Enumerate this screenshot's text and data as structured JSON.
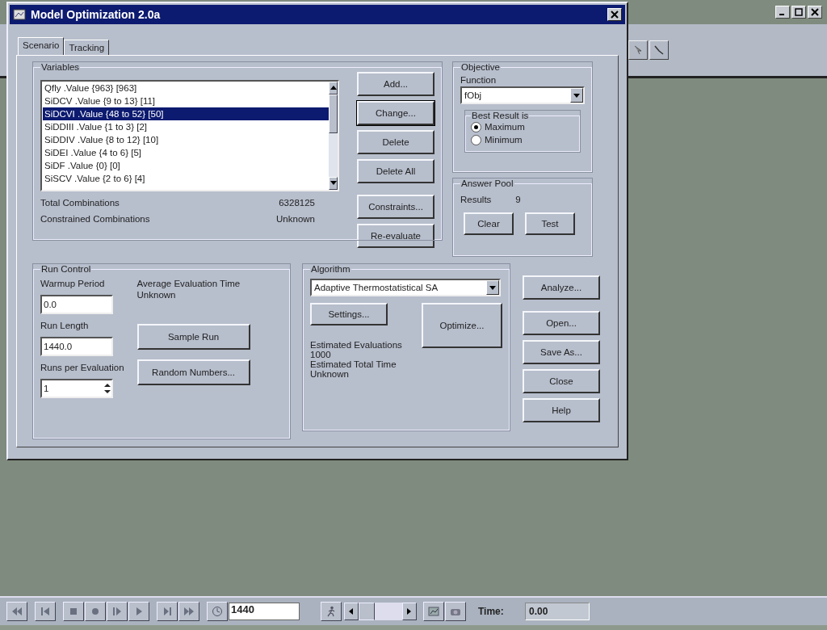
{
  "dialog": {
    "title": "Model Optimization 2.0a"
  },
  "tabs": [
    {
      "label": "Scenario",
      "selected": true
    },
    {
      "label": "Tracking",
      "selected": false
    }
  ],
  "variables": {
    "label": "Variables",
    "items": [
      {
        "text": "Qfly .Value {963} [963]",
        "selected": false
      },
      {
        "text": "SiDCV .Value {9 to 13} [11]",
        "selected": false
      },
      {
        "text": "SiDCVI .Value {48 to 52} [50]",
        "selected": true
      },
      {
        "text": "SiDDIII .Value {1 to 3} [2]",
        "selected": false
      },
      {
        "text": "SiDDIV .Value {8 to 12} [10]",
        "selected": false
      },
      {
        "text": "SiDEI .Value {4 to 6} [5]",
        "selected": false
      },
      {
        "text": "SiDF .Value {0} [0]",
        "selected": false
      },
      {
        "text": "SiSCV .Value {2 to 6} [4]",
        "selected": false
      }
    ],
    "total_label": "Total Combinations",
    "total_value": "6328125",
    "constrained_label": "Constrained Combinations",
    "constrained_value": "Unknown",
    "buttons": [
      {
        "label": "Add...",
        "focused": false
      },
      {
        "label": "Change...",
        "focused": true
      },
      {
        "label": "Delete",
        "focused": false
      },
      {
        "label": "Delete All",
        "focused": false
      },
      {
        "label": "Constraints...",
        "focused": false
      },
      {
        "label": "Re-evaluate",
        "focused": false
      }
    ]
  },
  "objective": {
    "label": "Objective",
    "function_label": "Function",
    "function_value": "fObj",
    "best_label": "Best Result is",
    "options": [
      {
        "label": "Maximum",
        "selected": true
      },
      {
        "label": "Minimum",
        "selected": false
      }
    ]
  },
  "answer_pool": {
    "label": "Answer Pool",
    "results_label": "Results",
    "results_value": "9",
    "buttons": [
      "Clear",
      "Test"
    ]
  },
  "run_control": {
    "label": "Run Control",
    "warmup_label": "Warmup Period",
    "warmup_value": "0.0",
    "avg_label": "Average Evaluation Time",
    "avg_value": "Unknown",
    "run_length_label": "Run Length",
    "run_length_value": "1440.0",
    "runs_label": "Runs per Evaluation",
    "runs_value": "1",
    "buttons": [
      "Sample Run",
      "Random Numbers..."
    ]
  },
  "algorithm": {
    "label": "Algorithm",
    "value": "Adaptive Thermostatistical SA",
    "settings": "Settings...",
    "optimize": "Optimize...",
    "est_eval_label": "Estimated Evaluations",
    "est_eval_value": "1000",
    "est_time_label": "Estimated Total Time",
    "est_time_value": "Unknown"
  },
  "side_buttons": [
    "Analyze...",
    "Open...",
    "Save As...",
    "Close",
    "Help"
  ],
  "toolbar": {
    "steps_value": "1440",
    "time_label": "Time:",
    "time_value": "0.00"
  }
}
